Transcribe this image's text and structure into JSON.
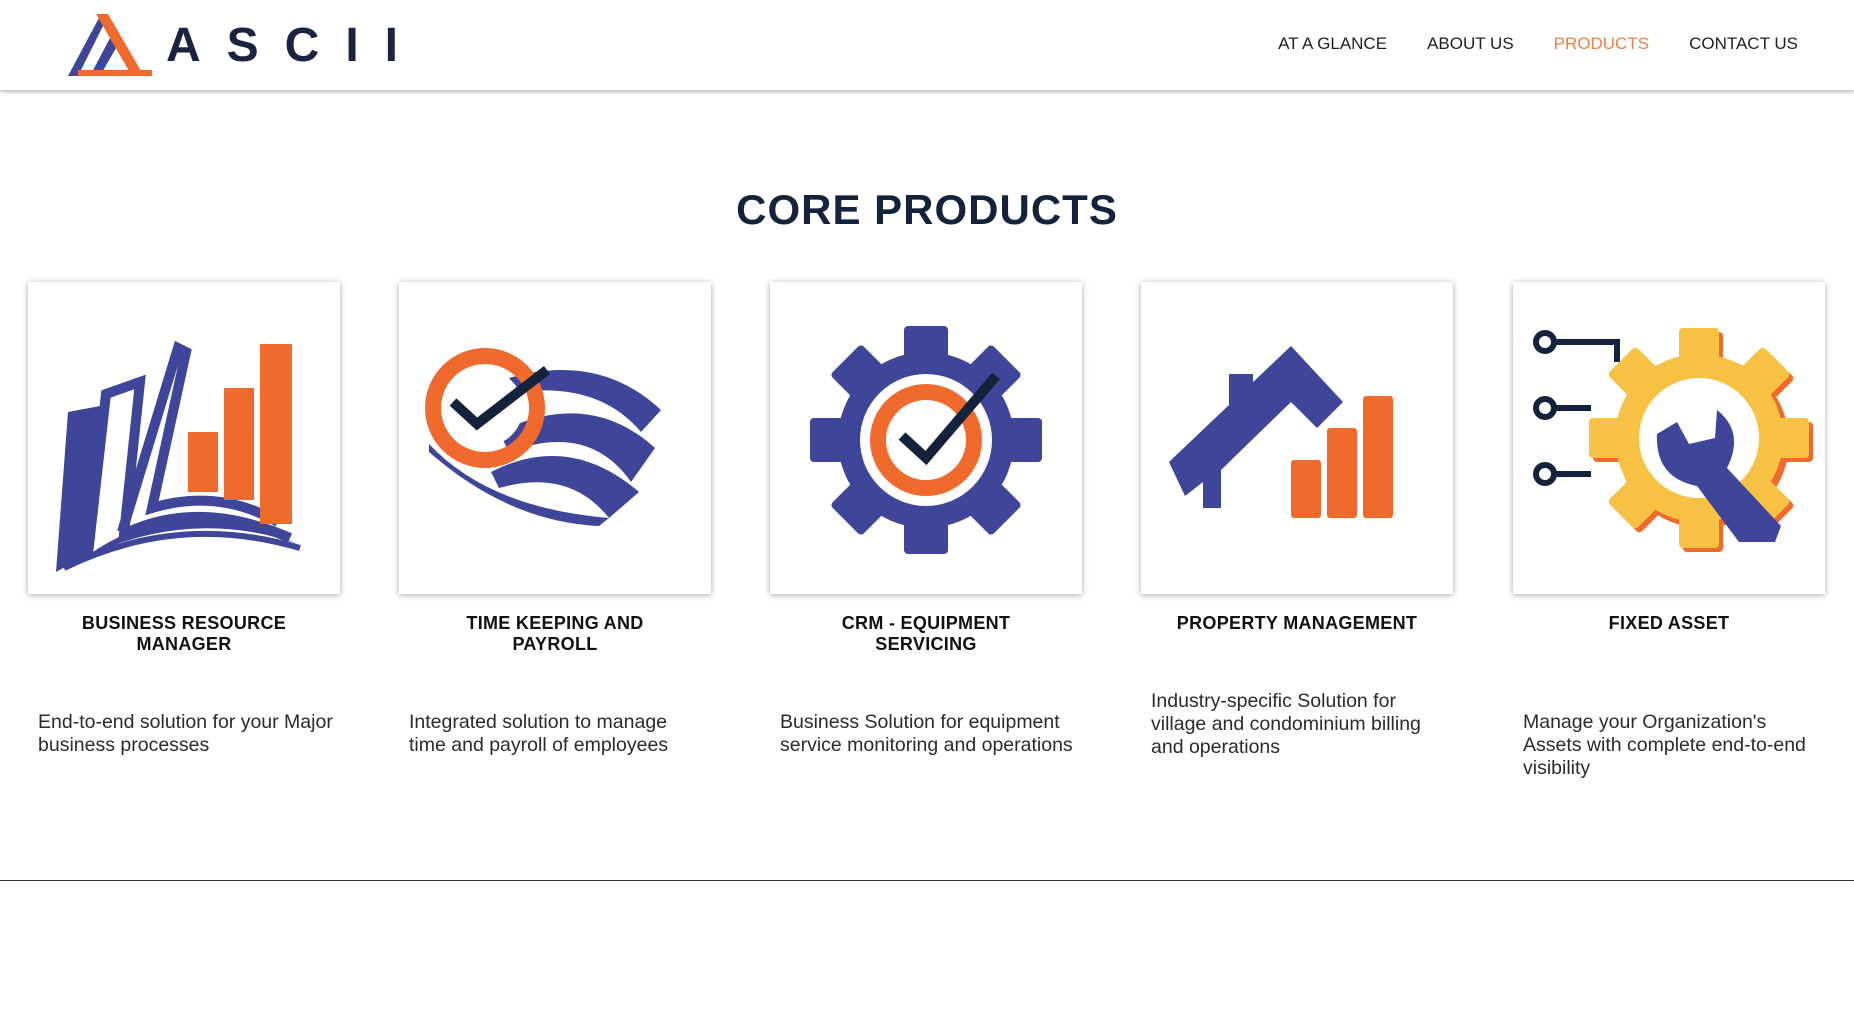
{
  "brand": {
    "name": "ASCII",
    "colors": {
      "navy": "#3f4599",
      "orange": "#f06a2e",
      "yellow": "#f7c244",
      "dark": "#15223b",
      "active_nav": "#ef7d46"
    }
  },
  "nav": {
    "items": [
      {
        "label": "AT A GLANCE",
        "active": false
      },
      {
        "label": "ABOUT US",
        "active": false
      },
      {
        "label": "PRODUCTS",
        "active": true
      },
      {
        "label": "CONTACT US",
        "active": false
      }
    ]
  },
  "section": {
    "title": "CORE PRODUCTS"
  },
  "products": [
    {
      "icon": "business-chart-icon",
      "title": "BUSINESS RESOURCE MANAGER",
      "description": "End-to-end solution for your Major business processes"
    },
    {
      "icon": "clock-payroll-icon",
      "title": "TIME KEEPING AND PAYROLL",
      "description": "Integrated solution to manage time and payroll of employees"
    },
    {
      "icon": "gear-check-icon",
      "title": "CRM - EQUIPMENT SERVICING",
      "description": "Business Solution for equipment service monitoring and operations"
    },
    {
      "icon": "house-chart-icon",
      "title": "PROPERTY MANAGEMENT",
      "description": "Industry-specific Solution for village and condominium billing and operations"
    },
    {
      "icon": "gear-wrench-icon",
      "title": "FIXED ASSET",
      "description": "Manage your Organization's Assets with complete end-to-end visibility"
    }
  ]
}
